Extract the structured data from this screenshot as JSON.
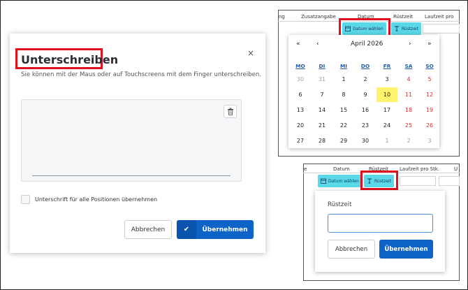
{
  "signature_dialog": {
    "title": "Unterschreiben",
    "close_icon": "×",
    "subtitle": "Sie können mit der Maus oder auf Touchscreens mit dem Finger unterschreiben.",
    "checkbox_label": "Unterschrift für alle Positionen übernehmen",
    "cancel_label": "Abbrechen",
    "confirm_label": "Übernehmen",
    "icons": [
      "trash-icon",
      "check-icon"
    ]
  },
  "calendar_panel": {
    "headers": [
      "ng",
      "Zusatzangabe",
      "Datum",
      "Rüstzeit",
      "Laufzeit pro"
    ],
    "date_chip_label": "Datum wählen",
    "setup_chip_label": "Rüstzeit",
    "nav_first": "«",
    "nav_prev": "‹",
    "month_label": "April 2026",
    "nav_next": "›",
    "nav_last": "»",
    "weekdays": [
      "MO",
      "DI",
      "MI",
      "DO",
      "FR",
      "SA",
      "SO"
    ],
    "weeks": [
      [
        "30",
        "31",
        "1",
        "2",
        "3",
        "4",
        "5"
      ],
      [
        "6",
        "7",
        "8",
        "9",
        "10",
        "11",
        "12"
      ],
      [
        "13",
        "14",
        "15",
        "16",
        "17",
        "18",
        "19"
      ],
      [
        "20",
        "21",
        "22",
        "23",
        "24",
        "25",
        "26"
      ],
      [
        "27",
        "28",
        "29",
        "30",
        "1",
        "2",
        "3"
      ]
    ],
    "selected_day": "10",
    "accent_color": "#5ad8e8",
    "weekend_color": "#d32f2f",
    "today_color": "#fff36b"
  },
  "setup_panel": {
    "headers": [
      "e",
      "Datum",
      "Rüstzeit",
      "Laufzeit pro Stk.",
      "U"
    ],
    "date_chip_label": "Datum wählen",
    "setup_chip_label": "Rüstzeit",
    "popup_label": "Rüstzeit",
    "input_value": "",
    "cancel_label": "Abbrechen",
    "confirm_label": "Übernehmen"
  },
  "colors": {
    "primary": "#0e63c9",
    "highlight_box": "#e0101e"
  }
}
